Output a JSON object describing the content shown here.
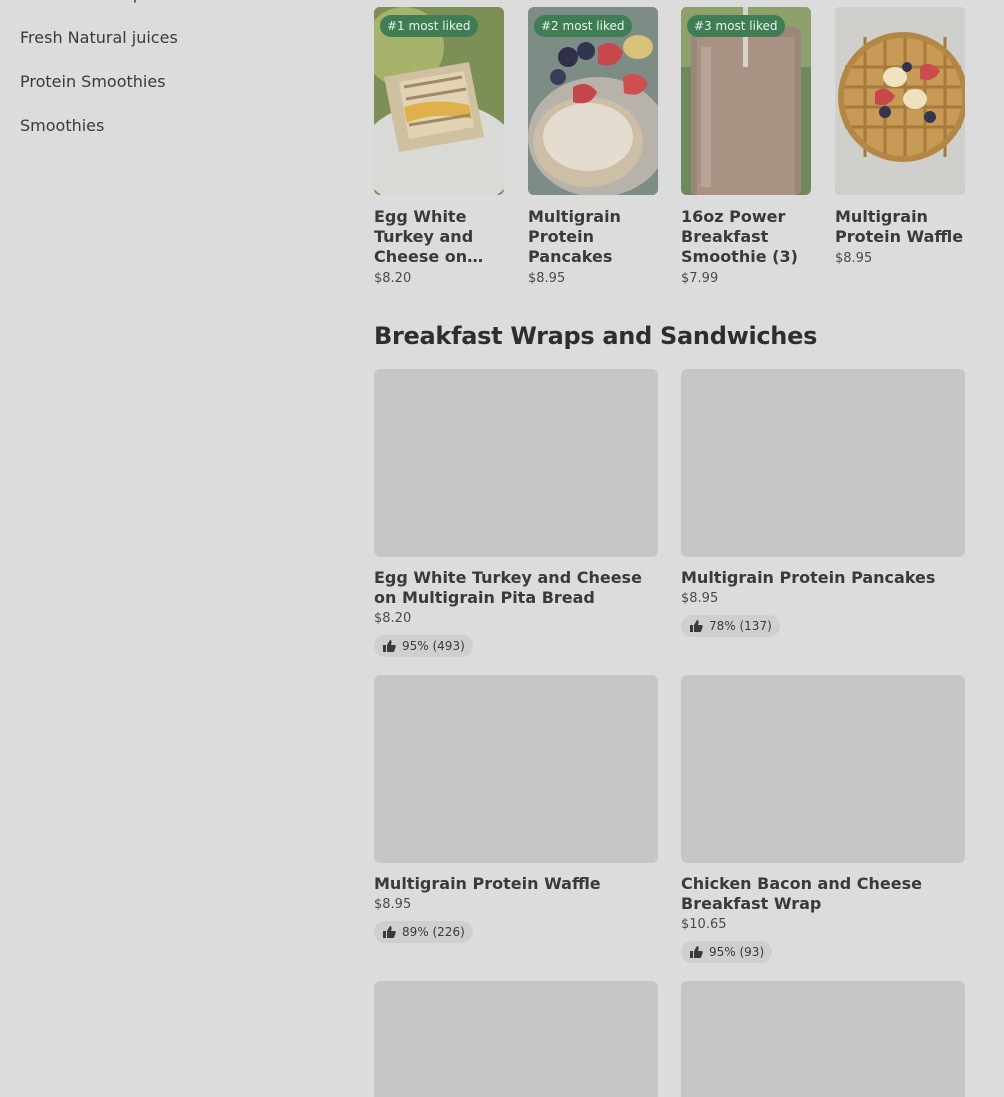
{
  "sidebar": {
    "items": [
      {
        "label": "Breakfast Wraps and Sandwiches"
      },
      {
        "label": "Fresh Natural juices"
      },
      {
        "label": "Protein Smoothies"
      },
      {
        "label": "Smoothies"
      }
    ]
  },
  "popular": [
    {
      "badge": "#1 most liked",
      "name": "Egg White Turkey and Cheese on Multigrain Pita Bread",
      "price": "$8.20"
    },
    {
      "badge": "#2 most liked",
      "name": "Multigrain Protein Pancakes",
      "price": "$8.95"
    },
    {
      "badge": "#3 most liked",
      "name": "16oz Power Breakfast Smoothie (3)",
      "price": "$7.99"
    },
    {
      "badge": "",
      "name": "Multigrain Protein Waffle",
      "price": "$8.95"
    }
  ],
  "section": {
    "title": "Breakfast Wraps and Sandwiches",
    "items": [
      {
        "name": "Egg White Turkey and Cheese on Multigrain Pita Bread",
        "price": "$8.20",
        "rating": "95% (493)"
      },
      {
        "name": "Multigrain Protein Pancakes",
        "price": "$8.95",
        "rating": "78% (137)"
      },
      {
        "name": "Multigrain Protein Waffle",
        "price": "$8.95",
        "rating": "89% (226)"
      },
      {
        "name": "Chicken Bacon and Cheese Breakfast Wrap",
        "price": "$10.65",
        "rating": "95% (93)"
      },
      {
        "name": "",
        "price": "",
        "rating": ""
      },
      {
        "name": "",
        "price": "",
        "rating": ""
      }
    ]
  },
  "colors": {
    "badge": "#3f7e54",
    "placeholder": "#c6c6c6",
    "background": "#dcdcdc"
  },
  "icons": {
    "rating": "thumbs-up-icon"
  }
}
